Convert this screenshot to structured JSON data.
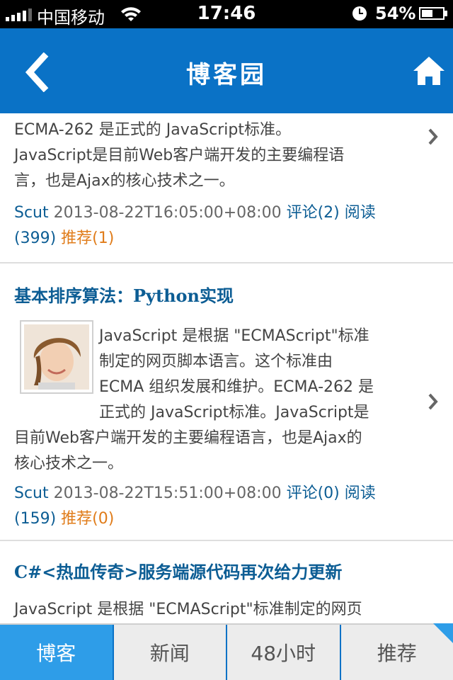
{
  "status_bar": {
    "carrier": "中国移动",
    "time": "17:46",
    "battery": "54%",
    "battery_level": 0.54
  },
  "nav": {
    "title": "博客园",
    "back_icon": "chevron-left-icon",
    "home_icon": "home-icon"
  },
  "posts": [
    {
      "summary_lines": [
        "ECMA-262 是正式的 JavaScript标准。",
        "JavaScript是目前Web客户端开发的主要编程语",
        "言，也是Ajax的核心技术之一。"
      ],
      "author": "Scut",
      "date": "2013-08-22T16:05:00+08:00",
      "comments": "评论(2)",
      "reads_label": "阅读",
      "reads_count": "(399)",
      "recommend": "推荐(1)"
    },
    {
      "title": "基本排序算法：Python实现",
      "summary_lines": [
        "JavaScript 是根据 \"ECMAScript\"标准",
        "制定的网页脚本语言。这个标准由",
        "ECMA 组织发展和维护。ECMA-262 是",
        "正式的 JavaScript标准。JavaScript是",
        "目前Web客户端开发的主要编程语言，也是Ajax的",
        "核心技术之一。"
      ],
      "author": "Scut",
      "date": "2013-08-22T15:51:00+08:00",
      "comments": "评论(0)",
      "reads_label": "阅读",
      "reads_count": "(159)",
      "recommend": "推荐(0)"
    },
    {
      "title": "C#<热血传奇>服务端源代码再次给力更新",
      "summary_lines": [
        "JavaScript 是根据 \"ECMAScript\"标准制定的网页"
      ]
    }
  ],
  "tabs": [
    {
      "label": "博客",
      "active": true
    },
    {
      "label": "新闻",
      "active": false
    },
    {
      "label": "48小时",
      "active": false
    },
    {
      "label": "推荐",
      "active": false
    }
  ],
  "colors": {
    "nav_bg": "#0a72c6",
    "link": "#0c5d94",
    "recommend": "#e07c1a",
    "tab_active": "#2e9de8"
  }
}
